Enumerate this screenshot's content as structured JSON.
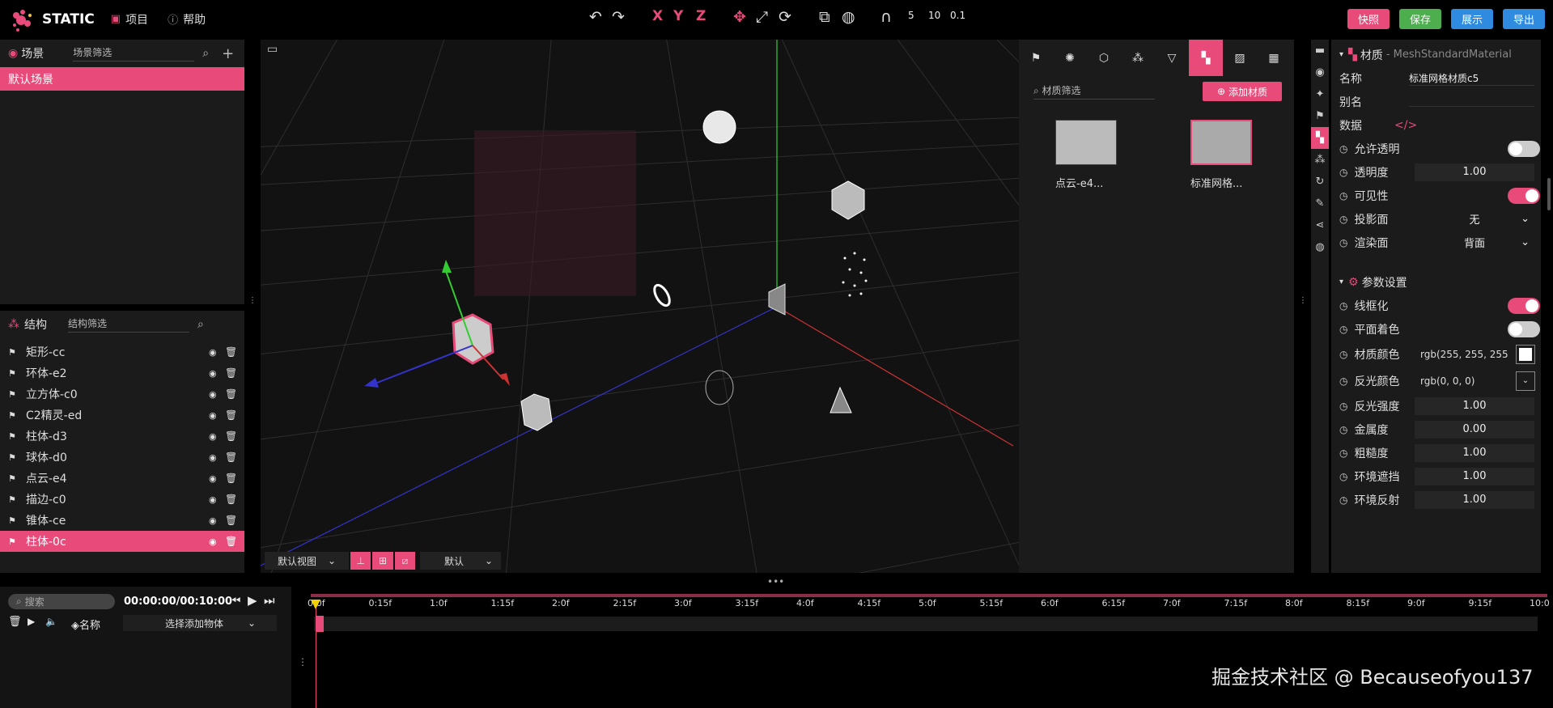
{
  "topbar": {
    "logo_text": "STATIC",
    "menu_project": "项目",
    "menu_help": "帮助",
    "snap_values": [
      "5",
      "10",
      "0.1"
    ],
    "buttons": {
      "shortcut": "快照",
      "save": "保存",
      "present": "展示",
      "export": "导出"
    },
    "button_colors": {
      "shortcut": "#e84a7a",
      "save": "#4cae4c",
      "present": "#2e8be0",
      "export": "#2e8be0"
    }
  },
  "scene_panel": {
    "title": "场景",
    "filter_placeholder": "场景筛选",
    "items": [
      "默认场景"
    ]
  },
  "structure_panel": {
    "title": "结构",
    "filter_placeholder": "结构筛选",
    "items": [
      {
        "name": "矩形-cc",
        "selected": false
      },
      {
        "name": "环体-e2",
        "selected": false
      },
      {
        "name": "立方体-c0",
        "selected": false
      },
      {
        "name": "C2精灵-ed",
        "selected": false
      },
      {
        "name": "柱体-d3",
        "selected": false
      },
      {
        "name": "球体-d0",
        "selected": false
      },
      {
        "name": "点云-e4",
        "selected": false
      },
      {
        "name": "描边-c0",
        "selected": false
      },
      {
        "name": "锥体-ce",
        "selected": false
      },
      {
        "name": "柱体-0c",
        "selected": true
      }
    ]
  },
  "viewport": {
    "view_select": "默认视图",
    "camera_select": "默认"
  },
  "material_panel": {
    "filter_placeholder": "材质筛选",
    "add_button": "添加材质",
    "materials": [
      {
        "label": "点云-e4...",
        "selected": false
      },
      {
        "label": "标准网格...",
        "selected": true
      }
    ]
  },
  "properties": {
    "material_header": "材质",
    "material_type": "- MeshStandardMaterial",
    "name_label": "名称",
    "name_value": "标准网格材质c5",
    "alias_label": "别名",
    "data_label": "数据",
    "transparent_label": "允许透明",
    "transparent_on": false,
    "opacity_label": "透明度",
    "opacity_value": "1.00",
    "visible_label": "可见性",
    "visible_on": true,
    "shadow_side_label": "投影面",
    "shadow_side_value": "无",
    "render_side_label": "渲染面",
    "render_side_value": "背面",
    "params_header": "参数设置",
    "wireframe_label": "线框化",
    "wireframe_on": true,
    "flat_label": "平面着色",
    "flat_on": false,
    "color_label": "材质颜色",
    "color_value": "rgb(255, 255, 255",
    "emissive_label": "反光颜色",
    "emissive_value": "rgb(0, 0, 0)",
    "emissive_intensity_label": "反光强度",
    "emissive_intensity_value": "1.00",
    "metalness_label": "金属度",
    "metalness_value": "0.00",
    "roughness_label": "粗糙度",
    "roughness_value": "1.00",
    "ao_label": "环境遮挡",
    "ao_value": "1.00",
    "env_label": "环境反射",
    "env_value": "1.00"
  },
  "timeline": {
    "search_placeholder": "搜索",
    "time_display": "00:00:00/00:10:00",
    "name_col": "名称",
    "add_object_select": "选择添加物体",
    "ticks": [
      "0:0f",
      "0:15f",
      "1:0f",
      "1:15f",
      "2:0f",
      "2:15f",
      "3:0f",
      "3:15f",
      "4:0f",
      "4:15f",
      "5:0f",
      "5:15f",
      "6:0f",
      "6:15f",
      "7:0f",
      "7:15f",
      "8:0f",
      "8:15f",
      "9:0f",
      "9:15f",
      "10:0"
    ]
  },
  "watermark": "掘金技术社区 @ Becauseofyou137",
  "colors": {
    "accent": "#e84a7a",
    "panel": "#1b1b1b",
    "viewport": "#121212"
  }
}
